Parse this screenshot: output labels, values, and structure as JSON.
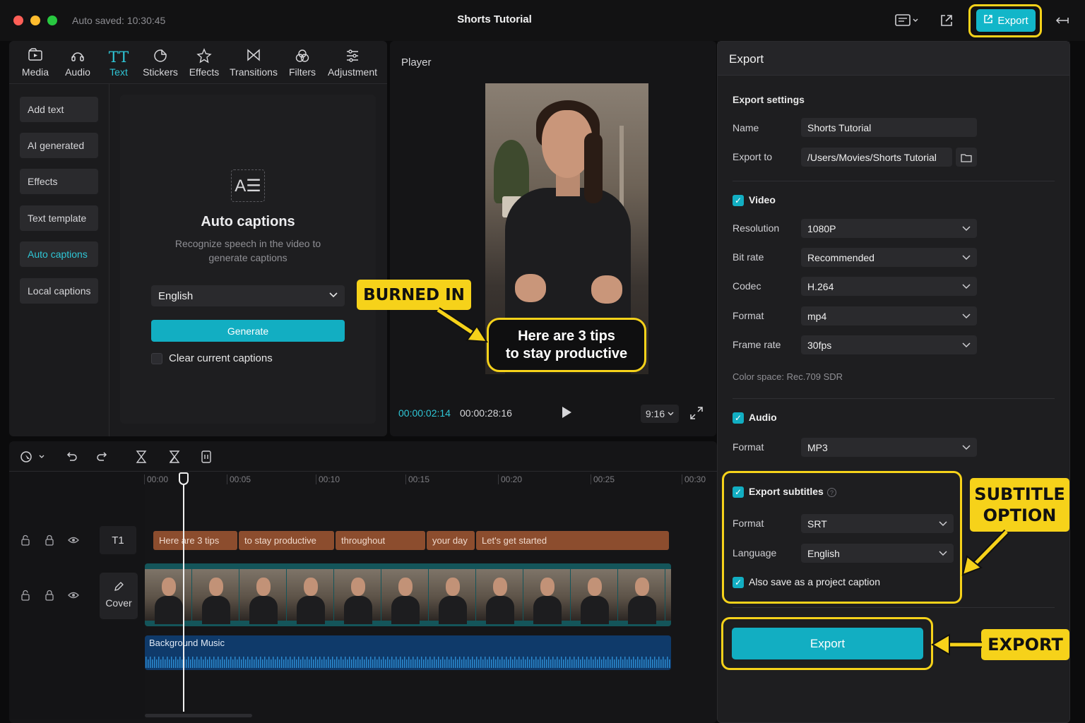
{
  "window": {
    "autosave": "Auto saved: 10:30:45",
    "title": "Shorts Tutorial",
    "export_button": "Export"
  },
  "toolbar": {
    "items": [
      {
        "label": "Media",
        "icon": "media-icon"
      },
      {
        "label": "Audio",
        "icon": "audio-icon"
      },
      {
        "label": "Text",
        "icon": "text-icon",
        "active": true
      },
      {
        "label": "Stickers",
        "icon": "stickers-icon"
      },
      {
        "label": "Effects",
        "icon": "effects-icon"
      },
      {
        "label": "Transitions",
        "icon": "transitions-icon"
      },
      {
        "label": "Filters",
        "icon": "filters-icon"
      },
      {
        "label": "Adjustment",
        "icon": "adjustment-icon"
      }
    ]
  },
  "sidebar": {
    "items": [
      {
        "label": "Add text"
      },
      {
        "label": "AI generated"
      },
      {
        "label": "Effects"
      },
      {
        "label": "Text template"
      },
      {
        "label": "Auto captions",
        "active": true
      },
      {
        "label": "Local captions"
      }
    ]
  },
  "auto_captions": {
    "icon_text": "A☰",
    "title": "Auto captions",
    "description": "Recognize speech in the video to generate captions",
    "language": "English",
    "generate_label": "Generate",
    "clear_label": "Clear current captions",
    "clear_checked": false
  },
  "player": {
    "title": "Player",
    "caption_line1": "Here are 3 tips",
    "caption_line2": "to stay productive",
    "timecode_current": "00:00:02:14",
    "timecode_total": "00:00:28:16",
    "ratio": "9:16"
  },
  "callouts": {
    "burned_in": "BURNED IN",
    "subtitle_option_1": "SUBTITLE",
    "subtitle_option_2": "OPTION",
    "export": "EXPORT"
  },
  "timeline": {
    "ruler": [
      "00:00",
      "00:05",
      "00:10",
      "00:15",
      "00:20",
      "00:25",
      "00:30"
    ],
    "text_track_label": "T1",
    "cover_label": "Cover",
    "caption_clips": [
      "Here are 3 tips",
      "to stay productive",
      "throughout",
      "your day",
      "Let's get started"
    ],
    "audio_label": "Background Music"
  },
  "export_panel": {
    "title": "Export",
    "settings_title": "Export settings",
    "name_label": "Name",
    "name_value": "Shorts Tutorial",
    "export_to_label": "Export to",
    "export_to_value": "/Users/Movies/Shorts Tutorial",
    "video": {
      "label": "Video",
      "checked": true,
      "resolution_label": "Resolution",
      "resolution": "1080P",
      "bitrate_label": "Bit rate",
      "bitrate": "Recommended",
      "codec_label": "Codec",
      "codec": "H.264",
      "format_label": "Format",
      "format": "mp4",
      "framerate_label": "Frame rate",
      "framerate": "30fps",
      "color_space": "Color space: Rec.709 SDR"
    },
    "audio": {
      "label": "Audio",
      "checked": true,
      "format_label": "Format",
      "format": "MP3"
    },
    "subtitles": {
      "label": "Export subtitles",
      "checked": true,
      "format_label": "Format",
      "format": "SRT",
      "language_label": "Language",
      "language": "English",
      "also_save_label": "Also save as a project caption",
      "also_save_checked": true
    },
    "export_button": "Export"
  },
  "colors": {
    "accent": "#12aec2",
    "highlight": "#f6d21a",
    "caption_clip": "#8c4d2e",
    "video_track": "#14555a",
    "audio_track": "#0f3a6a"
  }
}
